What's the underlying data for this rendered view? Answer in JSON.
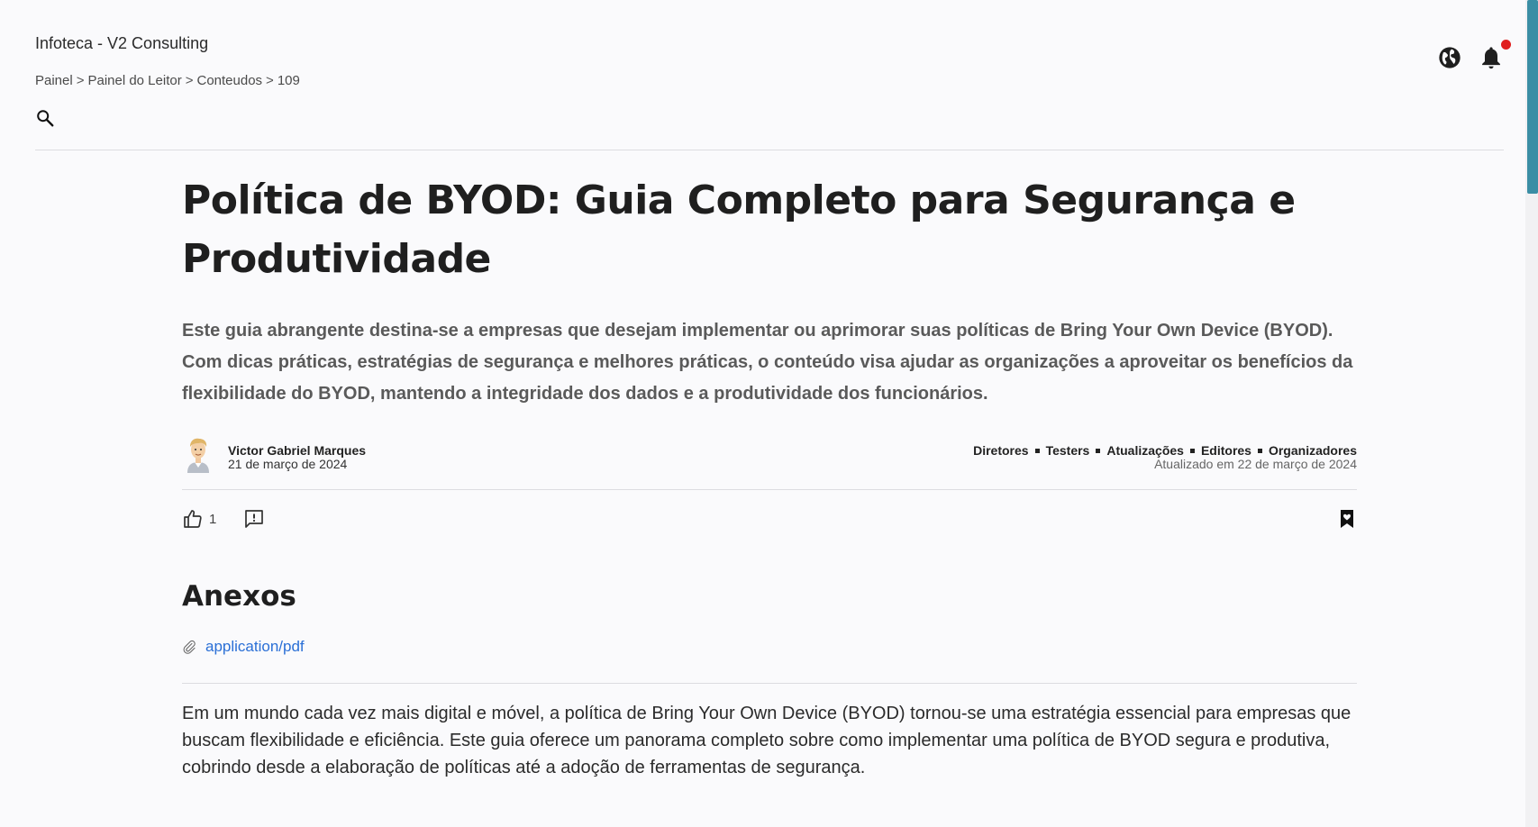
{
  "app": {
    "title": "Infoteca - V2 Consulting"
  },
  "breadcrumb": [
    "Painel",
    "Painel do Leitor",
    "Conteudos",
    "109"
  ],
  "breadcrumb_separator": ">",
  "icons": {
    "search": "search-icon",
    "language": "globe-icon",
    "notifications": "bell-icon",
    "like": "thumbs-up-icon",
    "report": "report-comment-icon",
    "bookmark": "bookmark-heart-icon",
    "attachment": "paperclip-icon"
  },
  "notifications": {
    "has_unread": true,
    "dot_color": "#e01e1e"
  },
  "article": {
    "title": "Política de BYOD: Guia Completo para Segurança e Produtividade",
    "summary": "Este guia abrangente destina-se a empresas que desejam implementar ou aprimorar suas políticas de Bring Your Own Device (BYOD). Com dicas práticas, estratégias de segurança e melhores práticas, o conteúdo visa ajudar as organizações a aproveitar os benefícios da flexibilidade do BYOD, mantendo a integridade dos dados e a produtividade dos funcionários.",
    "author": {
      "name": "Victor Gabriel Marques",
      "date": "21 de março de 2024"
    },
    "audiences": [
      "Diretores",
      "Testers",
      "Atualizações",
      "Editores",
      "Organizadores"
    ],
    "updated": "Atualizado em 22 de março de 2024",
    "likes": "1",
    "attachments_title": "Anexos",
    "attachments": [
      {
        "label": "application/pdf"
      }
    ],
    "body": "Em um mundo cada vez mais digital e móvel, a política de Bring Your Own Device (BYOD) tornou-se uma estratégia essencial para empresas que buscam flexibilidade e eficiência. Este guia oferece um panorama completo sobre como implementar uma política de BYOD segura e produtiva, cobrindo desde a elaboração de políticas até a adoção de ferramentas de segurança."
  },
  "colors": {
    "link": "#2a6fd6",
    "scrollbar_thumb": "#3b8ea5"
  }
}
